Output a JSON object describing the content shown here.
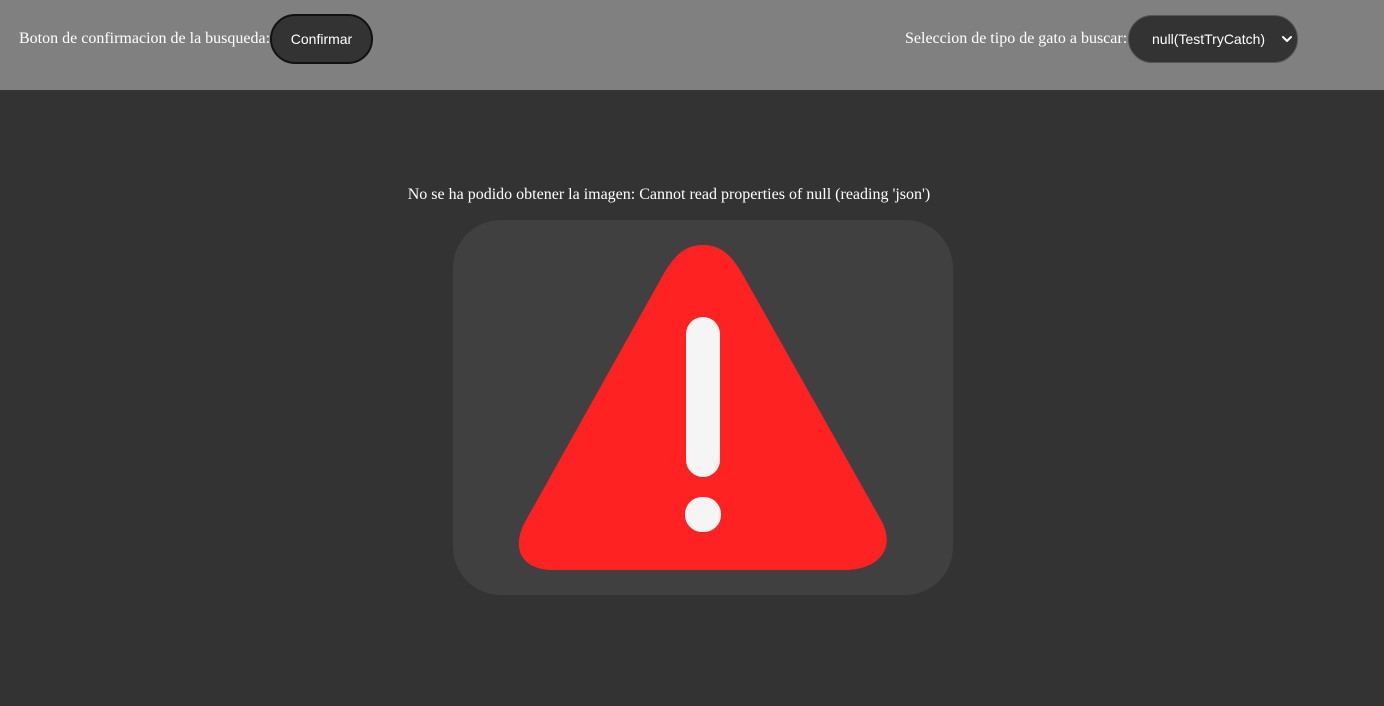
{
  "header": {
    "confirm_label_text": "Boton de confirmacion de la busqueda:",
    "confirm_button_label": "Confirmar",
    "select_label_text": "Seleccion de tipo de gato a buscar:",
    "select_value": "null(TestTryCatch)"
  },
  "main": {
    "error_message": "No se ha podido obtener la imagen: Cannot read properties of null (reading 'json')",
    "error_image_icon": "warning-triangle-icon"
  },
  "colors": {
    "header_bg": "#808080",
    "page_bg": "#333333",
    "frame_bg": "#404040",
    "warning_red": "#ff2222",
    "exclamation": "#f5f5f5"
  }
}
